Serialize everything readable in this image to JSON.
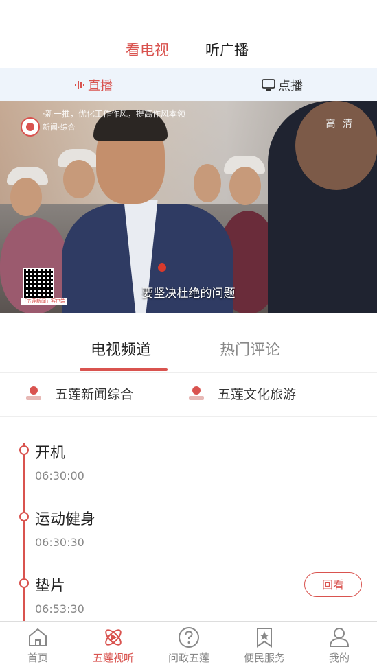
{
  "top_tabs": {
    "tv": "看电视",
    "radio": "听广播"
  },
  "subbar": {
    "live": "直播",
    "vod": "点播"
  },
  "video": {
    "ticker": "·新一推，优化工作作风，提高作风本领",
    "logo_text": "新闻·综合",
    "quality": "高 清",
    "qr_label": "「五莲新闻」客户端",
    "subtitle": "要坚决杜绝的问题"
  },
  "channel_tabs": {
    "tv": "电视频道",
    "hot": "热门评论"
  },
  "channels": [
    {
      "name": "五莲新闻综合",
      "logo": "新闻综合"
    },
    {
      "name": "五莲文化旅游",
      "logo": "文化旅游"
    }
  ],
  "schedule": [
    {
      "title": "开机",
      "time": "06:30:00"
    },
    {
      "title": "运动健身",
      "time": "06:30:30"
    },
    {
      "title": "垫片",
      "time": "06:53:30"
    }
  ],
  "replay_label": "回看",
  "bottom_nav": [
    {
      "label": "首页",
      "icon": "home-icon"
    },
    {
      "label": "五莲视听",
      "icon": "atom-icon"
    },
    {
      "label": "问政五莲",
      "icon": "question-icon"
    },
    {
      "label": "便民服务",
      "icon": "bookmark-star-icon"
    },
    {
      "label": "我的",
      "icon": "user-icon"
    }
  ],
  "colors": {
    "accent": "#d9534f",
    "subbar_bg": "#eef4fb"
  }
}
